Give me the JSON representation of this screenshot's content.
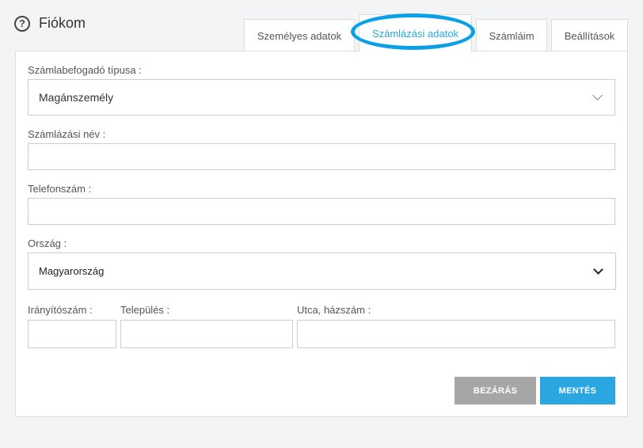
{
  "header": {
    "title": "Fiókom",
    "help_icon": "question-circle-icon",
    "help_glyph": "?"
  },
  "tabs": [
    {
      "label": "Személyes adatok",
      "active": false
    },
    {
      "label": "Számlázási adatok",
      "active": true
    },
    {
      "label": "Számláim",
      "active": false
    },
    {
      "label": "Beállítások",
      "active": false
    }
  ],
  "colors": {
    "accent": "#29a8df",
    "highlight_ring": "#0aa0e8",
    "close_button": "#a6a6a6",
    "save_button": "#2aa7e0"
  },
  "form": {
    "invoice_type": {
      "label": "Számlabefogadó típusa :",
      "value": "Magánszemély",
      "icon": "chevron-down-icon"
    },
    "billing_name": {
      "label": "Számlázási név :",
      "value": ""
    },
    "phone": {
      "label": "Telefonszám :",
      "value": ""
    },
    "country": {
      "label": "Ország :",
      "value": "Magyarország",
      "icon": "chevron-down-icon"
    },
    "zip": {
      "label": "Irányítószám :",
      "value": ""
    },
    "city": {
      "label": "Település :",
      "value": ""
    },
    "street": {
      "label": "Utca, házszám :",
      "value": ""
    }
  },
  "buttons": {
    "close": "BEZÁRÁS",
    "save": "MENTÉS"
  }
}
